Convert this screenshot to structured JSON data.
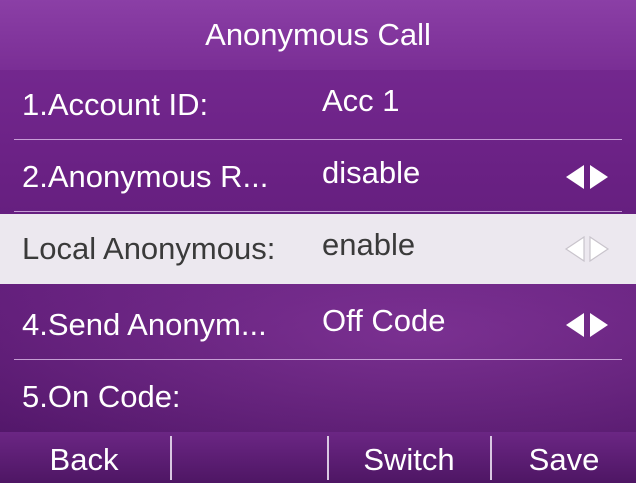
{
  "title": "Anonymous Call",
  "rows": [
    {
      "label": "1.Account ID:",
      "value": "Acc 1"
    },
    {
      "label": "2.Anonymous R...",
      "value": "disable"
    },
    {
      "label": "Local Anonymous:",
      "value": "enable"
    },
    {
      "label": "4.Send Anonym...",
      "value": "Off Code"
    },
    {
      "label": "5.On Code:",
      "value": ""
    }
  ],
  "softkeys": {
    "back": "Back",
    "empty": "",
    "switch": "Switch",
    "save": "Save"
  },
  "icons": {
    "switch_arrows": "left-right-arrows-icon"
  },
  "colors": {
    "background": "#6a2184",
    "selected_row": "#ece8ef",
    "text": "#ffffff"
  }
}
